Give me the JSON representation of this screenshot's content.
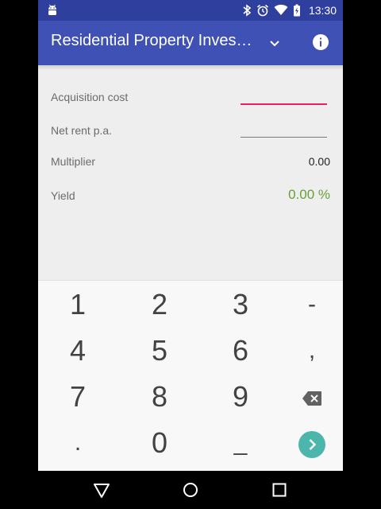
{
  "status_bar": {
    "time": "13:30",
    "icons": [
      "android-icon",
      "bluetooth-icon",
      "alarm-icon",
      "wifi-icon",
      "battery-icon"
    ]
  },
  "app_bar": {
    "title": "Residential Property Inves…",
    "color": "#3f51b5",
    "status_color": "#2f3f9e"
  },
  "form": {
    "acquisition_cost_label": "Acquisition cost",
    "net_rent_label": "Net rent p.a.",
    "multiplier_label": "Multiplier",
    "multiplier_value": "0.00",
    "yield_label": "Yield",
    "yield_value": "0.00 %",
    "accent_color": "#e91e63",
    "yield_color": "#689f38"
  },
  "keypad": {
    "keys": [
      "1",
      "2",
      "3",
      "-",
      "4",
      "5",
      "6",
      ",",
      "7",
      "8",
      "9",
      "backspace",
      ".",
      "0",
      "_",
      "next"
    ],
    "next_color": "#4db6ac"
  },
  "nav_bar": {
    "icons": [
      "back-icon",
      "home-icon",
      "recents-icon"
    ]
  }
}
